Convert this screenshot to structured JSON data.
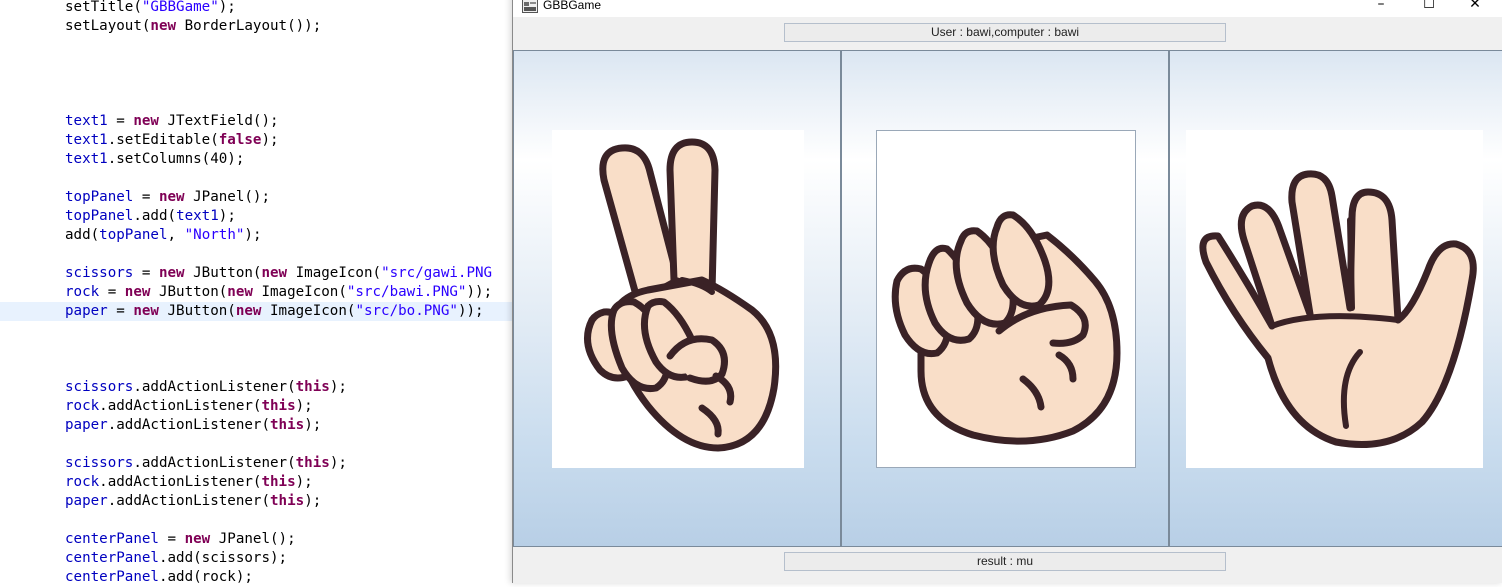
{
  "editor": {
    "lines": [
      {
        "segs": [
          {
            "t": "setTitle("
          },
          {
            "t": "\"GBBGame\"",
            "c": "s"
          },
          {
            "t": ");"
          }
        ]
      },
      {
        "segs": [
          {
            "t": "setLayout("
          },
          {
            "t": "new",
            "c": "k"
          },
          {
            "t": " BorderLayout());"
          }
        ]
      },
      {
        "segs": [
          {
            "t": "text1",
            "c": "f"
          },
          {
            "t": " = "
          },
          {
            "t": "new",
            "c": "k"
          },
          {
            "t": " JTextField();"
          }
        ]
      },
      {
        "segs": [
          {
            "t": "text1",
            "c": "f"
          },
          {
            "t": ".setEditable("
          },
          {
            "t": "false",
            "c": "k"
          },
          {
            "t": ");"
          }
        ]
      },
      {
        "segs": [
          {
            "t": "text1",
            "c": "f"
          },
          {
            "t": ".setColumns(40);"
          }
        ]
      },
      {
        "segs": [
          {
            "t": "topPanel",
            "c": "f"
          },
          {
            "t": " = "
          },
          {
            "t": "new",
            "c": "k"
          },
          {
            "t": " JPanel();"
          }
        ]
      },
      {
        "segs": [
          {
            "t": "topPanel",
            "c": "f"
          },
          {
            "t": ".add("
          },
          {
            "t": "text1",
            "c": "f"
          },
          {
            "t": ");"
          }
        ]
      },
      {
        "segs": [
          {
            "t": "add("
          },
          {
            "t": "topPanel",
            "c": "f"
          },
          {
            "t": ", "
          },
          {
            "t": "\"North\"",
            "c": "s"
          },
          {
            "t": ");"
          }
        ]
      },
      {
        "segs": [
          {
            "t": "scissors",
            "c": "f"
          },
          {
            "t": " = "
          },
          {
            "t": "new",
            "c": "k"
          },
          {
            "t": " JButton("
          },
          {
            "t": "new",
            "c": "k"
          },
          {
            "t": " ImageIcon("
          },
          {
            "t": "\"src/gawi.PNG",
            "c": "s"
          }
        ]
      },
      {
        "segs": [
          {
            "t": "rock",
            "c": "f"
          },
          {
            "t": " = "
          },
          {
            "t": "new",
            "c": "k"
          },
          {
            "t": " JButton("
          },
          {
            "t": "new",
            "c": "k"
          },
          {
            "t": " ImageIcon("
          },
          {
            "t": "\"src/bawi.PNG\"",
            "c": "s"
          },
          {
            "t": "));"
          }
        ]
      },
      {
        "segs": [
          {
            "t": "paper",
            "c": "f"
          },
          {
            "t": " = "
          },
          {
            "t": "new",
            "c": "k"
          },
          {
            "t": " JButton("
          },
          {
            "t": "new",
            "c": "k"
          },
          {
            "t": " ImageIcon("
          },
          {
            "t": "\"src/bo.PNG\"",
            "c": "s"
          },
          {
            "t": "));"
          }
        ]
      },
      {
        "segs": [
          {
            "t": "scissors",
            "c": "f"
          },
          {
            "t": ".addActionListener("
          },
          {
            "t": "this",
            "c": "k"
          },
          {
            "t": ");"
          }
        ]
      },
      {
        "segs": [
          {
            "t": "rock",
            "c": "f"
          },
          {
            "t": ".addActionListener("
          },
          {
            "t": "this",
            "c": "k"
          },
          {
            "t": ");"
          }
        ]
      },
      {
        "segs": [
          {
            "t": "paper",
            "c": "f"
          },
          {
            "t": ".addActionListener("
          },
          {
            "t": "this",
            "c": "k"
          },
          {
            "t": ");"
          }
        ]
      },
      {
        "segs": [
          {
            "t": "scissors",
            "c": "f"
          },
          {
            "t": ".addActionListener("
          },
          {
            "t": "this",
            "c": "k"
          },
          {
            "t": ");"
          }
        ]
      },
      {
        "segs": [
          {
            "t": "rock",
            "c": "f"
          },
          {
            "t": ".addActionListener("
          },
          {
            "t": "this",
            "c": "k"
          },
          {
            "t": ");"
          }
        ]
      },
      {
        "segs": [
          {
            "t": "paper",
            "c": "f"
          },
          {
            "t": ".addActionListener("
          },
          {
            "t": "this",
            "c": "k"
          },
          {
            "t": ");"
          }
        ]
      },
      {
        "segs": [
          {
            "t": "centerPanel",
            "c": "f"
          },
          {
            "t": " = "
          },
          {
            "t": "new",
            "c": "k"
          },
          {
            "t": " JPanel();"
          }
        ]
      },
      {
        "segs": [
          {
            "t": "centerPanel",
            "c": "f"
          },
          {
            "t": ".add(scissors);"
          }
        ]
      },
      {
        "segs": [
          {
            "t": "centerPanel",
            "c": "f"
          },
          {
            "t": ".add(rock);"
          }
        ]
      }
    ],
    "colors": {
      "keyword": "#7f0055",
      "field": "#0000c0",
      "string": "#2a00ff",
      "current_line": "#e8f2fe"
    }
  },
  "window": {
    "title": "GBBGame",
    "icon": "java-app-icon",
    "controls": {
      "minimize": "–",
      "maximize": "☐",
      "close": "✕"
    },
    "top_text": "User : bawi,computer : bawi",
    "bottom_text": "result : mu",
    "buttons": [
      {
        "name": "scissors",
        "icon": "scissors-hand-icon"
      },
      {
        "name": "rock",
        "icon": "rock-fist-icon"
      },
      {
        "name": "paper",
        "icon": "paper-open-hand-icon"
      }
    ]
  }
}
